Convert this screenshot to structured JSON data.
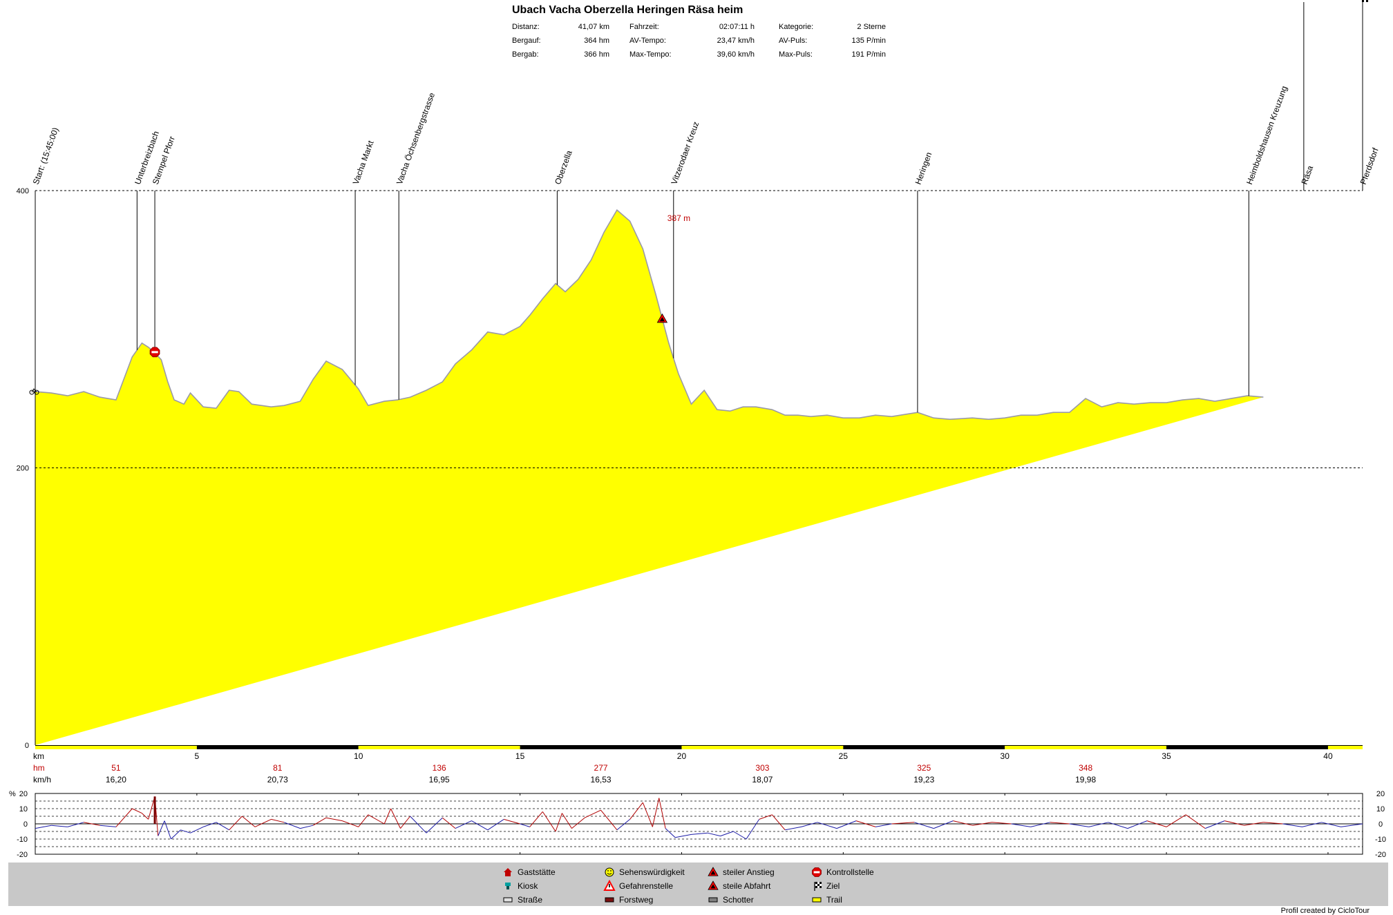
{
  "title": "Ubach Vacha Oberzella Heringen Räsa heim",
  "stats": [
    {
      "label": "Distanz:",
      "value": "41,07 km"
    },
    {
      "label": "Bergauf:",
      "value": "364 hm"
    },
    {
      "label": "Bergab:",
      "value": "366 hm"
    },
    {
      "label": "Fahrzeit:",
      "value": "02:07:11 h"
    },
    {
      "label": "AV-Tempo:",
      "value": "23,47 km/h"
    },
    {
      "label": "Max-Tempo:",
      "value": "39,60 km/h"
    },
    {
      "label": "Kategorie:",
      "value": "2 Sterne"
    },
    {
      "label": "AV-Puls:",
      "value": "135 P/min"
    },
    {
      "label": "Max-Puls:",
      "value": "191 P/min"
    }
  ],
  "chart_data": [
    {
      "type": "area",
      "unit_label": "km",
      "xlim": [
        0,
        41.07
      ],
      "ylim": [
        0,
        400
      ],
      "yticks": [
        0,
        200,
        400
      ],
      "xticks": [
        5,
        10,
        15,
        20,
        25,
        30,
        35,
        40
      ],
      "grid": "horizontal dashed at 200 and 400",
      "fill_color": "#ffff00",
      "line_color": "#9a9aa6",
      "x": [
        0,
        0.5,
        1,
        1.5,
        2,
        2.5,
        3,
        3.3,
        3.5,
        3.7,
        3.9,
        4.1,
        4.3,
        4.6,
        4.8,
        5.2,
        5.6,
        6,
        6.3,
        6.7,
        7.3,
        7.7,
        8.2,
        8.6,
        9,
        9.5,
        10,
        10.3,
        10.8,
        11.2,
        11.6,
        12.1,
        12.6,
        13,
        13.5,
        14,
        14.5,
        15,
        15.3,
        15.7,
        16.1,
        16.4,
        16.8,
        17.2,
        17.6,
        18,
        18.4,
        18.8,
        19.2,
        19.6,
        19.9,
        20.3,
        20.7,
        21.1,
        21.5,
        21.9,
        22.3,
        22.8,
        23.2,
        23.6,
        24,
        24.5,
        25,
        25.5,
        26,
        26.5,
        27.3,
        27.8,
        28.3,
        29,
        29.5,
        30,
        30.5,
        31,
        31.5,
        32,
        32.5,
        33,
        33.5,
        34,
        34.5,
        35,
        35.5,
        36,
        36.5,
        37,
        37.5,
        38,
        38.6,
        39.2,
        39.7,
        40.2,
        40.7,
        41.07
      ],
      "y": [
        255,
        254,
        252,
        255,
        251,
        249,
        280,
        290,
        287,
        283,
        278,
        262,
        249,
        246,
        254,
        244,
        243,
        256,
        255,
        246,
        244,
        245,
        248,
        264,
        277,
        271,
        257,
        245,
        248,
        249,
        251,
        256,
        262,
        275,
        285,
        298,
        296,
        302,
        310,
        322,
        333,
        327,
        336,
        350,
        370,
        386,
        378,
        358,
        325,
        290,
        268,
        246,
        256,
        242,
        241,
        244,
        244,
        242,
        238,
        238,
        237,
        238,
        236,
        236,
        238,
        237,
        240,
        236,
        235,
        236,
        235,
        236,
        238,
        238,
        240,
        240,
        250,
        244,
        247,
        246,
        247,
        247,
        249,
        250,
        248,
        250,
        252,
        251
      ],
      "markers": [
        {
          "km": 0,
          "label": "Start: (15:45:00)"
        },
        {
          "km": 3.15,
          "label": "Unterbreizbach"
        },
        {
          "km": 3.7,
          "label": "Stempel Pforr"
        },
        {
          "km": 9.9,
          "label": "Vacha Markt"
        },
        {
          "km": 11.25,
          "label": "Vacha Öchsenbergstrasse"
        },
        {
          "km": 16.15,
          "label": "Oberzella"
        },
        {
          "km": 19.75,
          "label": "Vitzerodaer Kreuz"
        },
        {
          "km": 27.3,
          "label": "Heringen"
        },
        {
          "km": 37.55,
          "label": "Heimboldshausen Kreuzung"
        },
        {
          "km": 39.25,
          "label": "Räsa"
        },
        {
          "km": 41.07,
          "label": "Pferdsdorf"
        }
      ],
      "peak": {
        "km": 19.75,
        "label": "387 m"
      },
      "symbols": [
        {
          "km": 0,
          "type": "bike-start-icon"
        },
        {
          "km": 3.7,
          "type": "stop-icon"
        },
        {
          "km": 19.4,
          "type": "steep-climb-icon"
        },
        {
          "km": 39.25,
          "type": "stop-icon"
        },
        {
          "km": 41.07,
          "type": "finish-flag-icon"
        }
      ],
      "surface": [
        {
          "from": 0,
          "to": 5,
          "type": "Trail"
        },
        {
          "from": 5,
          "to": 10,
          "type": "Straße"
        },
        {
          "from": 10,
          "to": 15,
          "type": "Trail"
        },
        {
          "from": 15,
          "to": 20,
          "type": "Straße"
        },
        {
          "from": 20,
          "to": 25,
          "type": "Trail"
        },
        {
          "from": 25,
          "to": 30,
          "type": "Straße"
        },
        {
          "from": 30,
          "to": 35,
          "type": "Trail"
        },
        {
          "from": 35,
          "to": 40,
          "type": "Straße"
        },
        {
          "from": 40,
          "to": 41.07,
          "type": "Trail"
        }
      ]
    },
    {
      "type": "line",
      "ylabel": "%",
      "ylim": [
        -20,
        20
      ],
      "yticks": [
        -20,
        -10,
        0,
        10,
        20
      ],
      "grid": "horizontal dashed every 5 %",
      "x": [
        0,
        0.5,
        1,
        1.5,
        2,
        2.5,
        3,
        3.3,
        3.5,
        3.7,
        3.8,
        4,
        4.2,
        4.5,
        4.8,
        5.2,
        5.6,
        6,
        6.4,
        6.8,
        7.3,
        7.7,
        8.2,
        8.6,
        9,
        9.5,
        10,
        10.3,
        10.8,
        11,
        11.3,
        11.6,
        12.1,
        12.6,
        13,
        13.5,
        14,
        14.5,
        15,
        15.3,
        15.7,
        16.1,
        16.3,
        16.6,
        17,
        17.5,
        18,
        18.4,
        18.8,
        19.1,
        19.3,
        19.5,
        19.8,
        20.3,
        20.8,
        21.2,
        21.6,
        22,
        22.4,
        22.8,
        23.2,
        23.7,
        24.2,
        24.8,
        25.4,
        26,
        26.5,
        27.2,
        27.8,
        28.4,
        29,
        29.6,
        30.2,
        30.8,
        31.4,
        32,
        32.6,
        33.2,
        33.8,
        34.4,
        35,
        35.6,
        36.2,
        36.8,
        37.4,
        38,
        38.6,
        39.2,
        39.8,
        40.4,
        41.07
      ],
      "y": [
        -3,
        -1,
        -2,
        1,
        -1,
        -2,
        10,
        7,
        3,
        18,
        -8,
        2,
        -10,
        -4,
        -6,
        -2,
        1,
        -4,
        5,
        -2,
        3,
        1,
        -3,
        -1,
        4,
        2,
        -2,
        6,
        0,
        10,
        -3,
        5,
        -6,
        4,
        -3,
        2,
        -4,
        3,
        0,
        -2,
        8,
        -5,
        7,
        -3,
        4,
        9,
        -4,
        3,
        14,
        -2,
        17,
        -3,
        -9,
        -7,
        -6,
        -8,
        -5,
        -10,
        3,
        6,
        -4,
        -2,
        1,
        -3,
        2,
        -2,
        0,
        1,
        -3,
        2,
        -1,
        1,
        0,
        -2,
        1,
        0,
        -2,
        1,
        -3,
        2,
        -2,
        6,
        -3,
        2,
        -1,
        1,
        0,
        -2,
        1,
        -2,
        0
      ]
    }
  ],
  "axis_rows": {
    "km_label": "km",
    "hm_label": "hm",
    "kmh_label": "km/h",
    "hm_values": [
      "51",
      "81",
      "136",
      "277",
      "303",
      "325",
      "348"
    ],
    "kmh_values": [
      "16,20",
      "20,73",
      "16,95",
      "16,53",
      "18,07",
      "19,23",
      "19,98"
    ],
    "hm_color": "#c00000"
  },
  "legend": [
    {
      "icon": "house-icon",
      "label": "Gaststätte",
      "color": "#c00000"
    },
    {
      "icon": "kiosk-icon",
      "label": "Kiosk",
      "color": "#00a0a0"
    },
    {
      "icon": "road-swatch-icon",
      "label": "Straße",
      "color": "#e0e0e0"
    },
    {
      "icon": "smiley-icon",
      "label": "Sehenswürdigkeit",
      "color": "#ffff00"
    },
    {
      "icon": "warning-icon",
      "label": "Gefahrenstelle",
      "color": "#ff0000"
    },
    {
      "icon": "forest-road-swatch-icon",
      "label": "Forstweg",
      "color": "#7a1010"
    },
    {
      "icon": "steep-climb-icon",
      "label": "steiler Anstieg",
      "color": "#ff0000"
    },
    {
      "icon": "steep-descent-icon",
      "label": "steile Abfahrt",
      "color": "#ff0000"
    },
    {
      "icon": "gravel-swatch-icon",
      "label": "Schotter",
      "color": "#808080"
    },
    {
      "icon": "stop-icon",
      "label": "Kontrollstelle",
      "color": "#ff0000"
    },
    {
      "icon": "finish-flag-icon",
      "label": "Ziel",
      "color": "#000000"
    },
    {
      "icon": "trail-swatch-icon",
      "label": "Trail",
      "color": "#ffff00"
    }
  ],
  "credit": "Profil created by CicloTour"
}
